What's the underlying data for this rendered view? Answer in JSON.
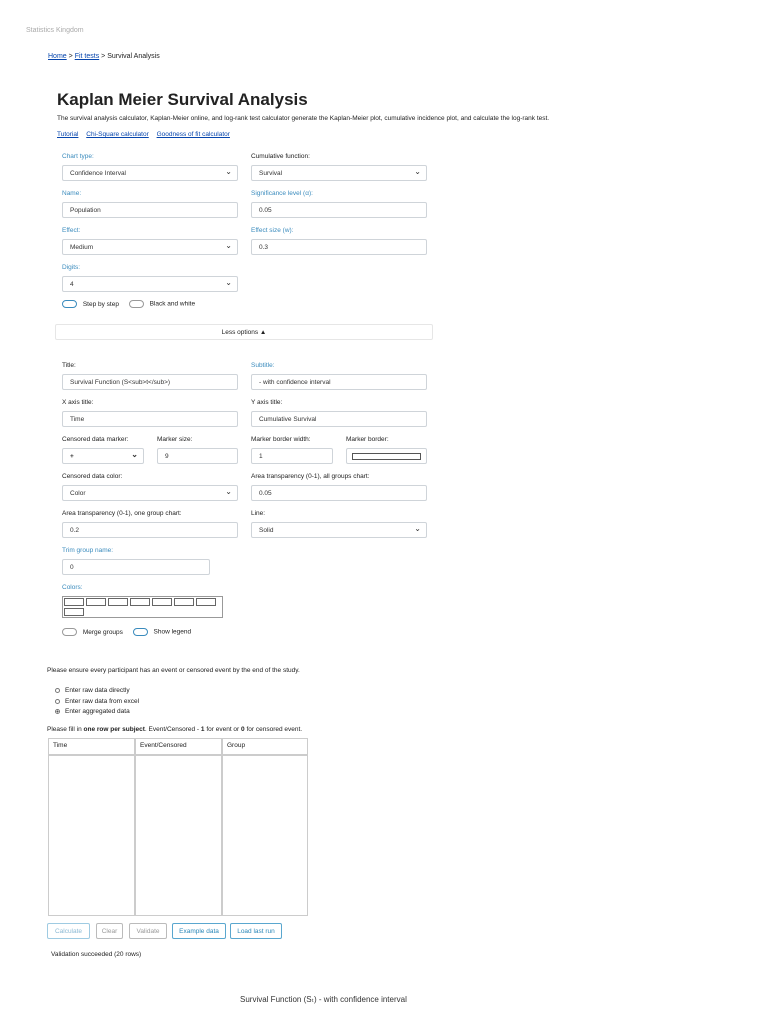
{
  "site_name": "Statistics Kingdom",
  "breadcrumb": {
    "home": "Home",
    "fit_tests": "Fit tests",
    "current": "Survival Analysis",
    "sep": ">"
  },
  "page": {
    "title": "Kaplan Meier Survival Analysis",
    "intro": "The survival analysis calculator, Kaplan-Meier online, and log-rank test calculator generate the Kaplan-Meier plot, cumulative incidence plot, and calculate the log-rank test.",
    "links": [
      "Tutorial",
      "Chi-Square calculator",
      "Goodness of fit calculator"
    ]
  },
  "form": {
    "chart_type": {
      "label": "Chart type:",
      "value": "Confidence Interval"
    },
    "cumulative_function": {
      "label": "Cumulative function:",
      "value": "Survival"
    },
    "name": {
      "label": "Name:",
      "value": "Population"
    },
    "significance": {
      "label": "Significance level (α):",
      "value": "0.05"
    },
    "effect": {
      "label": "Effect:",
      "value": "Medium"
    },
    "effect_size": {
      "label": "Effect size (w):",
      "value": "0.3"
    },
    "digits": {
      "label": "Digits:",
      "value": "4"
    },
    "step_by_step": {
      "label": "Step by step",
      "on": true
    },
    "black_white": {
      "label": "Black and white",
      "on": false
    },
    "less_options": "Less options ▲",
    "title": {
      "label": "Title:",
      "value": "Survival Function (S<sub>t</sub>)"
    },
    "subtitle": {
      "label": "Subtitle:",
      "value": "- with confidence interval"
    },
    "x_axis": {
      "label": "X axis title:",
      "value": "Time"
    },
    "y_axis": {
      "label": "Y axis title:",
      "value": "Cumulative Survival"
    },
    "censored_marker": {
      "label": "Censored data marker:",
      "value": "+"
    },
    "marker_size": {
      "label": "Marker size:",
      "value": "9"
    },
    "marker_border_width": {
      "label": "Marker border width:",
      "value": "1"
    },
    "marker_border": {
      "label": "Marker border:"
    },
    "censored_color": {
      "label": "Censored data color:",
      "value": "Color"
    },
    "area_transparency_all": {
      "label": "Area transparency (0-1), all groups chart:",
      "value": "0.05"
    },
    "area_transparency_one": {
      "label": "Area transparency (0-1), one group chart:",
      "value": "0.2"
    },
    "line": {
      "label": "Line:",
      "value": "Solid"
    },
    "trim_group": {
      "label": "Trim group name:",
      "value": "0"
    },
    "colors": {
      "label": "Colors:"
    },
    "merge_groups": {
      "label": "Merge groups",
      "on": false
    },
    "show_legend": {
      "label": "Show legend",
      "on": true
    }
  },
  "data_entry": {
    "notice": "Please ensure every participant has an event or censored event by the end of the study.",
    "options": [
      {
        "label": "Enter raw data directly",
        "checked": false
      },
      {
        "label": "Enter raw data from excel",
        "checked": false
      },
      {
        "label": "Enter aggregated data",
        "checked": true
      }
    ],
    "fill_pre": "Please fill in ",
    "fill_bold1": "one row per subject",
    "fill_mid": ". Event/Censored - ",
    "fill_bold2": "1",
    "fill_mid2": " for event or ",
    "fill_bold3": "0",
    "fill_post": " for censored event.",
    "columns": [
      "Time",
      "Event/Censored",
      "Group"
    ]
  },
  "buttons": {
    "calculate": "Calculate",
    "clear": "Clear",
    "validate": "Validate",
    "example": "Example data",
    "load_last": "Load last run"
  },
  "status": "Validation succeeded (20 rows)",
  "chart_title_partial": "Survival Function (Sₜ) - with confidence interval"
}
